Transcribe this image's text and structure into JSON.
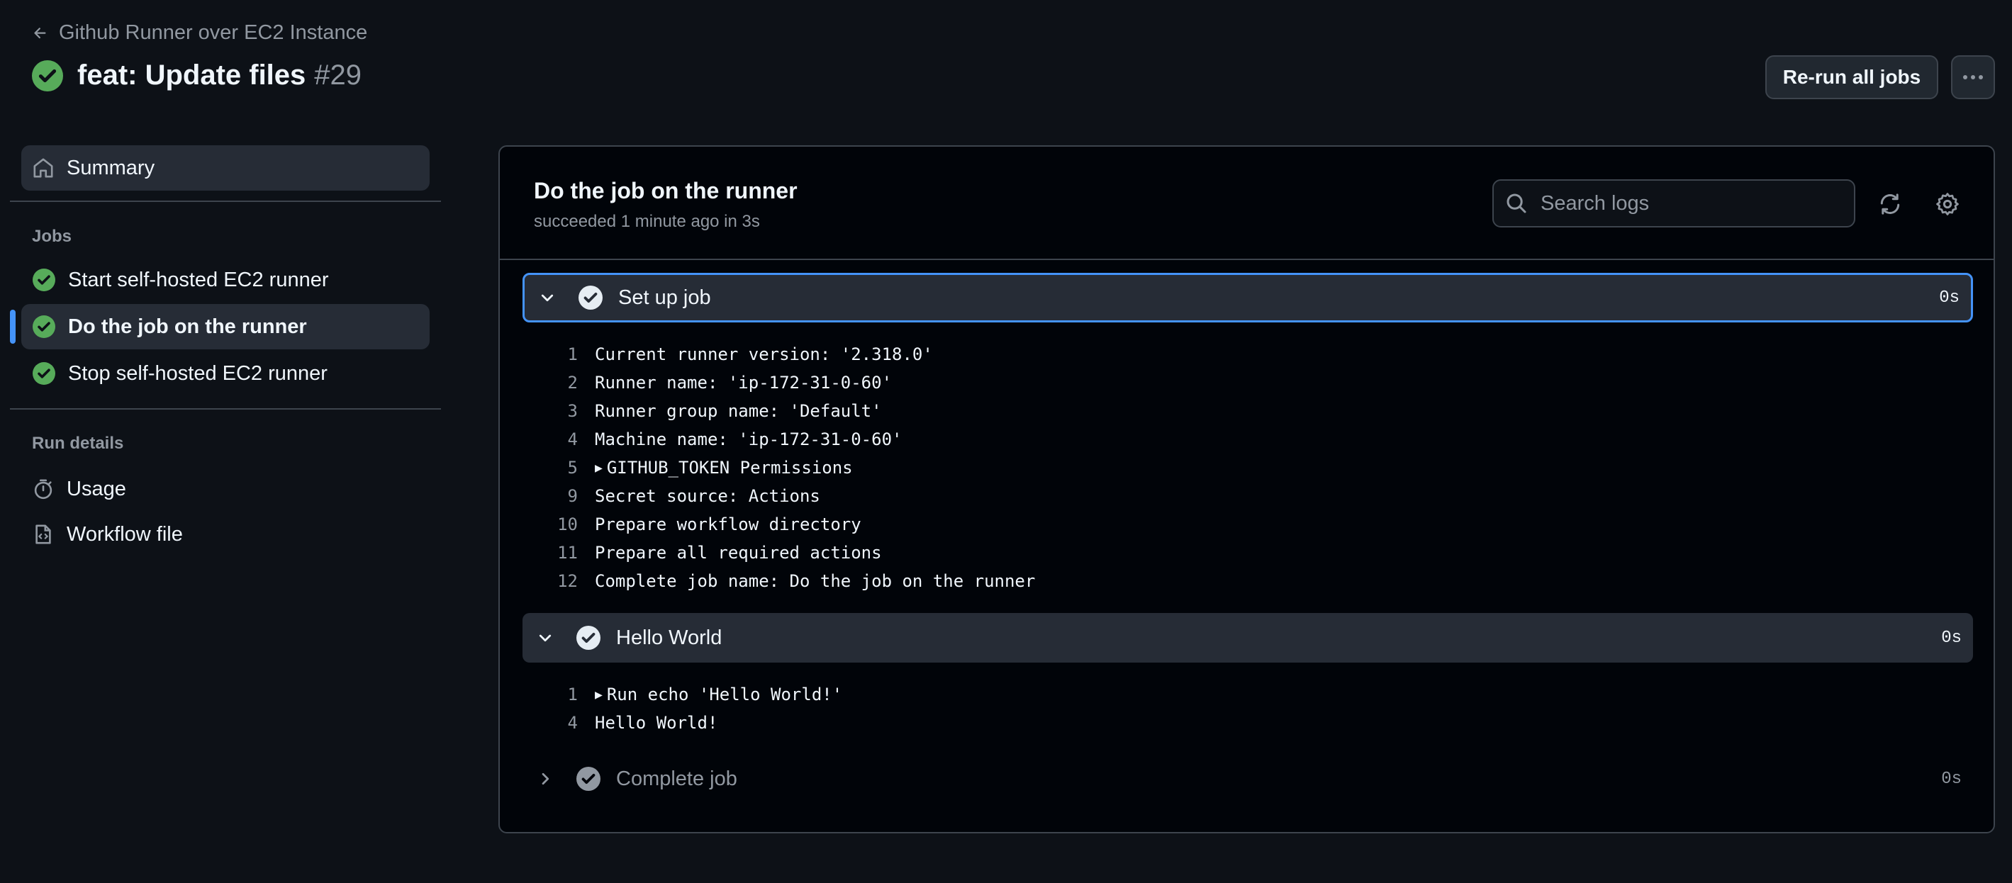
{
  "header": {
    "back_label": "Github Runner over EC2 Instance",
    "title": "feat: Update files",
    "run_number": "#29",
    "rerun_label": "Re-run all jobs"
  },
  "sidebar": {
    "summary_label": "Summary",
    "jobs_heading": "Jobs",
    "jobs": [
      {
        "label": "Start self-hosted EC2 runner"
      },
      {
        "label": "Do the job on the runner"
      },
      {
        "label": "Stop self-hosted EC2 runner"
      }
    ],
    "run_details_heading": "Run details",
    "details": [
      {
        "label": "Usage"
      },
      {
        "label": "Workflow file"
      }
    ]
  },
  "job": {
    "title": "Do the job on the runner",
    "status": "succeeded 1 minute ago in 3s",
    "search_placeholder": "Search logs"
  },
  "steps": [
    {
      "name": "Set up job",
      "duration": "0s",
      "lines": [
        {
          "n": "1",
          "text": "Current runner version: '2.318.0'"
        },
        {
          "n": "2",
          "text": "Runner name: 'ip-172-31-0-60'"
        },
        {
          "n": "3",
          "text": "Runner group name: 'Default'"
        },
        {
          "n": "4",
          "text": "Machine name: 'ip-172-31-0-60'"
        },
        {
          "n": "5",
          "text": "GITHUB_TOKEN Permissions"
        },
        {
          "n": "9",
          "text": "Secret source: Actions"
        },
        {
          "n": "10",
          "text": "Prepare workflow directory"
        },
        {
          "n": "11",
          "text": "Prepare all required actions"
        },
        {
          "n": "12",
          "text": "Complete job name: Do the job on the runner"
        }
      ]
    },
    {
      "name": "Hello World",
      "duration": "0s",
      "lines": [
        {
          "n": "1",
          "text": "Run echo 'Hello World!'"
        },
        {
          "n": "4",
          "text": "Hello World!"
        }
      ]
    },
    {
      "name": "Complete job",
      "duration": "0s",
      "lines": []
    }
  ],
  "colors": {
    "background": "#0d1117",
    "panel": "#010409",
    "success": "#57ab5a",
    "accent": "#4493f8",
    "muted_text": "#9198a1"
  }
}
